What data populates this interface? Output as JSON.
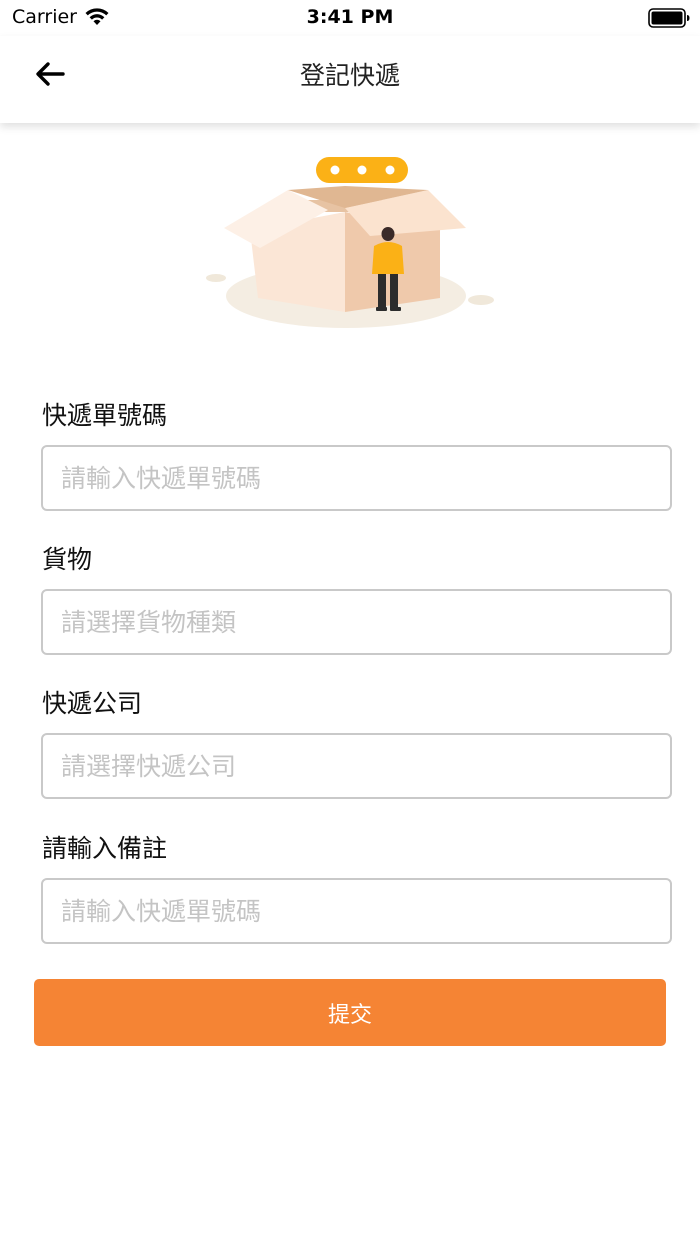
{
  "status_bar": {
    "carrier": "Carrier",
    "time": "3:41 PM",
    "wifi_icon": "wifi-icon",
    "battery_icon": "battery-icon"
  },
  "nav": {
    "back_icon": "arrow-left-icon",
    "title": "登記快遞"
  },
  "illustration": {
    "icon": "open-box-with-person-illustration",
    "colors": {
      "box": "#fbe6d6",
      "box_dark": "#efc9ab",
      "bubble": "#fbb116",
      "shirt": "#fbb116",
      "ground": "#f4ede2"
    }
  },
  "form": {
    "tracking": {
      "label": "快遞單號碼",
      "placeholder": "請輸入快遞單號碼",
      "value": ""
    },
    "goods": {
      "label": "貨物",
      "placeholder": "請選擇貨物種類",
      "value": ""
    },
    "courier": {
      "label": "快遞公司",
      "placeholder": "請選擇快遞公司",
      "value": ""
    },
    "remark": {
      "label": "請輸入備註",
      "placeholder": "請輸入快遞單號碼",
      "value": ""
    },
    "submit_label": "提交"
  },
  "colors": {
    "accent": "#f58434",
    "border": "#c9c9c9",
    "placeholder": "#c4c4c4"
  }
}
